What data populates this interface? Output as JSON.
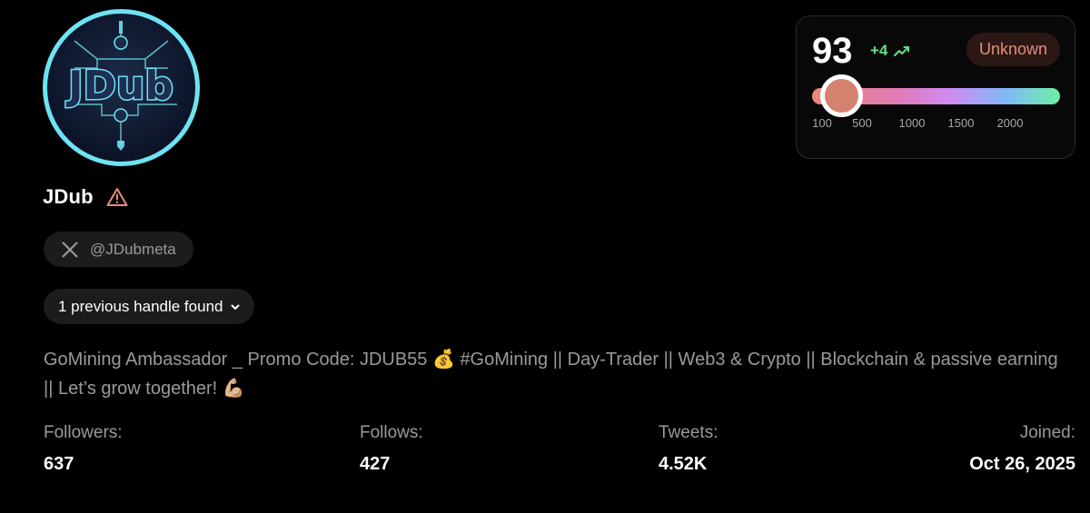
{
  "profile": {
    "name": "JDub",
    "handle": "@JDubmeta",
    "previous_handles_label": "1 previous handle found",
    "bio": "GoMining Ambassador _ Promo Code: JDUB55 💰 #GoMining || Day-Trader || Web3 & Crypto || Blockchain & passive earning || Let’s grow together! 💪🏼",
    "avatar_text": "JDub"
  },
  "stats": [
    {
      "label": "Followers:",
      "value": "637"
    },
    {
      "label": "Follows:",
      "value": "427"
    },
    {
      "label": "Tweets:",
      "value": "4.52K"
    },
    {
      "label": "Joined:",
      "value": "Oct 26, 2025"
    }
  ],
  "score": {
    "value": "93",
    "delta": "+4",
    "status": "Unknown",
    "ticks": [
      "100",
      "500",
      "1000",
      "1500",
      "2000"
    ],
    "tick_values": [
      100,
      500,
      1000,
      1500,
      2000
    ],
    "current_value": 93
  },
  "icons": {
    "warning": "warning-triangle-icon",
    "x_logo": "x-logo-icon",
    "chevron": "chevron-down-icon",
    "trend": "trending-up-icon"
  },
  "colors": {
    "background": "#000000",
    "avatar_ring": "#6ee3f2",
    "warning": "#e38f7c",
    "delta_green": "#5ee08a",
    "muted_text": "#9a9a9a"
  }
}
